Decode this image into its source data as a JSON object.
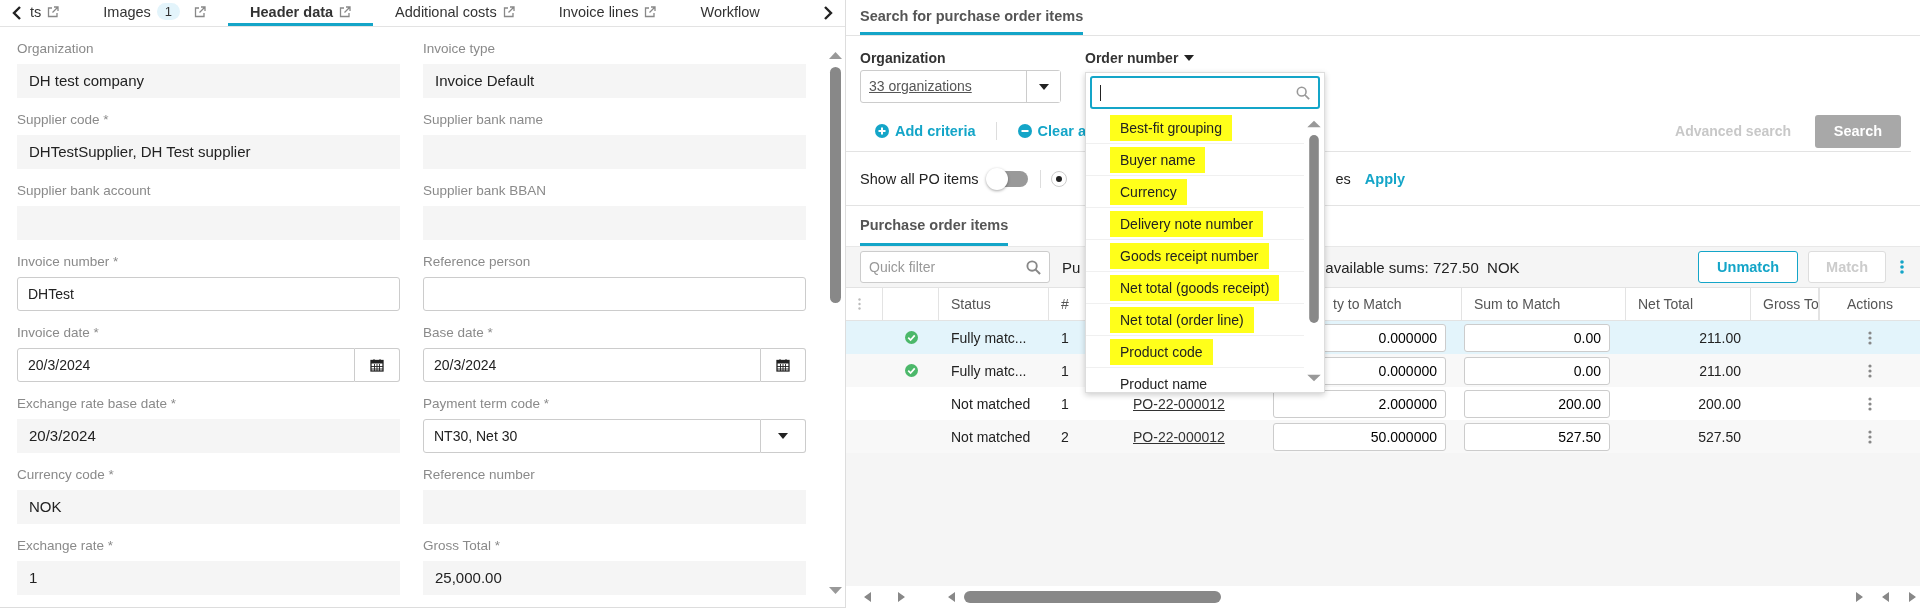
{
  "tabs": [
    {
      "label": "ts",
      "external": true,
      "selected": false
    },
    {
      "label": "Images",
      "badge": "1",
      "external": true,
      "selected": false
    },
    {
      "label": "Header data",
      "external": true,
      "selected": true
    },
    {
      "label": "Additional costs",
      "external": true,
      "selected": false
    },
    {
      "label": "Invoice lines",
      "external": true,
      "selected": false
    },
    {
      "label": "Workflow",
      "external": false,
      "selected": false
    }
  ],
  "form": {
    "fields": [
      {
        "label": "Organization",
        "kind": "readonly",
        "value": "DH test company"
      },
      {
        "label": "Invoice type",
        "kind": "readonly",
        "value": "Invoice Default"
      },
      {
        "label": "Supplier code *",
        "kind": "readonly",
        "value": "DHTestSupplier, DH Test supplier"
      },
      {
        "label": "Supplier bank name",
        "kind": "readonly"
      },
      {
        "label": "Supplier bank account",
        "kind": "readonly"
      },
      {
        "label": "Supplier bank BBAN",
        "kind": "readonly"
      },
      {
        "label": "Invoice number *",
        "kind": "input",
        "value": "DHTest"
      },
      {
        "label": "Reference person",
        "kind": "input"
      },
      {
        "label": "Invoice date *",
        "kind": "date",
        "value": "20/3/2024"
      },
      {
        "label": "Base date *",
        "kind": "date",
        "value": "20/3/2024"
      },
      {
        "label": "Exchange rate base date *",
        "kind": "readonly",
        "value": "20/3/2024"
      },
      {
        "label": "Payment term code *",
        "kind": "select",
        "value": "NT30, Net 30"
      },
      {
        "label": "Currency code *",
        "kind": "readonly",
        "value": "NOK"
      },
      {
        "label": "Reference number",
        "kind": "readonly"
      },
      {
        "label": "Exchange rate *",
        "kind": "readonly",
        "value": "1"
      },
      {
        "label": "Gross Total *",
        "kind": "readonly",
        "value": "25,000.00"
      }
    ]
  },
  "search_panel": {
    "tab": {
      "label": "Search for purchase order items",
      "selected": true
    },
    "organization": {
      "label": "Organization",
      "value": "33 organizations"
    },
    "order_number": {
      "label": "Order number"
    },
    "add_criteria": "Add criteria",
    "clear_all": "Clear a",
    "advanced_search": {
      "label": "Advanced search",
      "disabled": true
    },
    "search_button": {
      "label": "Search",
      "disabled": true
    },
    "show_all_po": {
      "label": "Show all PO items",
      "on": false
    },
    "radio": {
      "selected": true
    },
    "radio_label_end": "es",
    "apply": "Apply"
  },
  "items_panel": {
    "tab": {
      "label": "Purchase order items",
      "selected": true
    },
    "quick_filter": {
      "placeholder": "Quick filter"
    },
    "summary_fragments": [
      "Pu",
      "available sums: 727.50  NOK"
    ],
    "unmatch": {
      "label": "Unmatch",
      "disabled": false
    },
    "match": {
      "label": "Match",
      "disabled": true
    },
    "table": {
      "columns": [
        "Status",
        "#",
        "ty to Match",
        "Sum to Match",
        "Net Total",
        "Gross To",
        "Actions"
      ],
      "rows": [
        {
          "selected": true,
          "matched": true,
          "status": "Fully matc...",
          "number": "1",
          "quantity": "0.000000",
          "sum": "0.00",
          "net_total": "211.00"
        },
        {
          "selected": false,
          "matched": true,
          "status": "Fully matc...",
          "number": "1",
          "quantity": "0.000000",
          "sum": "0.00",
          "net_total": "211.00"
        },
        {
          "selected": false,
          "matched": false,
          "status": "Not matched",
          "number": "1",
          "order": "PO-22-000012",
          "quantity": "2.000000",
          "sum": "200.00",
          "net_total": "200.00"
        },
        {
          "selected": false,
          "matched": false,
          "status": "Not matched",
          "number": "2",
          "order": "PO-22-000012",
          "quantity": "50.000000",
          "sum": "527.50",
          "net_total": "527.50"
        }
      ]
    }
  },
  "dropdown": {
    "items": [
      {
        "label": "Best-fit grouping",
        "highlighted": true
      },
      {
        "label": "Buyer name",
        "highlighted": true
      },
      {
        "label": "Currency",
        "highlighted": true
      },
      {
        "label": "Delivery note number",
        "highlighted": true
      },
      {
        "label": "Goods receipt number",
        "highlighted": true
      },
      {
        "label": "Net total (goods receipt)",
        "highlighted": true
      },
      {
        "label": "Net total (order line)",
        "highlighted": true
      },
      {
        "label": "Product code",
        "highlighted": true
      },
      {
        "label": "Product name",
        "highlighted": false
      }
    ]
  }
}
